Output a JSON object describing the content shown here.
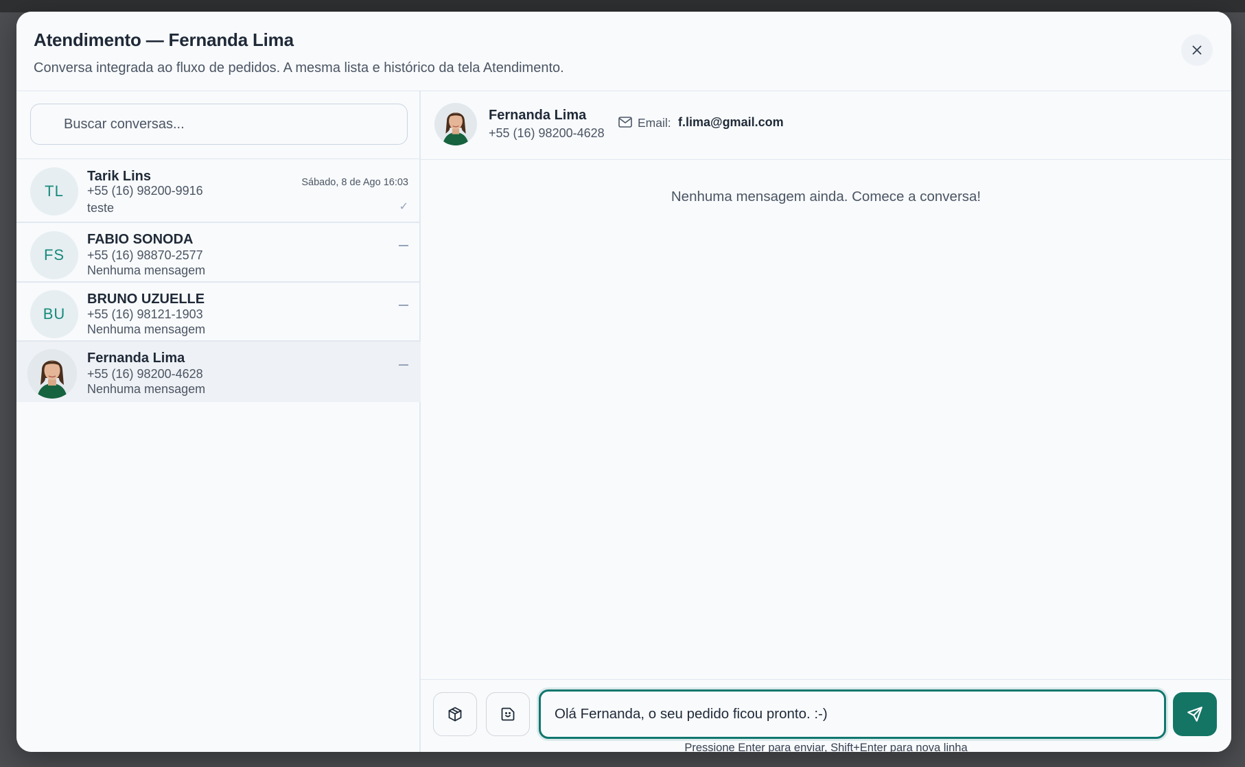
{
  "modal": {
    "title": "Atendimento — Fernanda Lima",
    "subtitle": "Conversa integrada ao fluxo de pedidos. A mesma lista e histórico da tela Atendimento.",
    "close_icon": "close-icon"
  },
  "search": {
    "placeholder": "Buscar conversas...",
    "value": ""
  },
  "conversations": [
    {
      "initials": "TL",
      "name": "Tarik Lins",
      "phone": "+55 (16) 98200-9916",
      "last_message": "teste",
      "time": "Sábado, 8 de Ago 16:03",
      "status": "✓"
    },
    {
      "initials": "FS",
      "name": "FABIO SONODA",
      "phone": "+55 (16) 98870-2577",
      "last_message": "Nenhuma mensagem",
      "time": "",
      "status": ""
    },
    {
      "initials": "BU",
      "name": "BRUNO UZUELLE",
      "phone": "+55 (16) 98121-1903",
      "last_message": "Nenhuma mensagem",
      "time": "",
      "status": ""
    },
    {
      "initials": "",
      "name": "Fernanda Lima",
      "phone": "+55 (16) 98200-4628",
      "last_message": "Nenhuma mensagem",
      "time": "",
      "status": "",
      "active": true
    }
  ],
  "chat": {
    "name": "Fernanda Lima",
    "phone": "+55 (16) 98200-4628",
    "email_label": "Email:",
    "email": "f.lima@gmail.com",
    "empty_message": "Nenhuma mensagem ainda. Comece a conversa!"
  },
  "composer": {
    "value": "Olá Fernanda, o seu pedido ficou pronto. :-)",
    "hint": "Pressione Enter para enviar, Shift+Enter para nova linha",
    "tool_icons": [
      "package-icon",
      "sticker-icon"
    ],
    "send_icon": "send-icon"
  },
  "colors": {
    "accent": "#147565",
    "avatar_bg": "#e6eef1",
    "avatar_text": "#178a7c"
  }
}
